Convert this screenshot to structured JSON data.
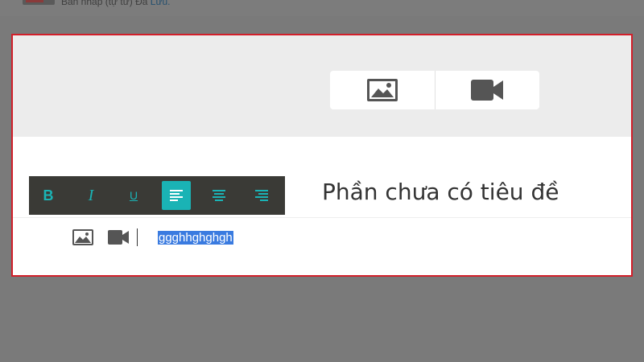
{
  "topbar": {
    "status_prefix": "Bản nháp (tự từ) Đã",
    "status_link": "Lưu."
  },
  "header": {
    "media_buttons": [
      {
        "icon": "image-icon",
        "label": ""
      },
      {
        "icon": "video-camera-icon",
        "label": ""
      }
    ]
  },
  "section": {
    "title": "Phần chưa có tiêu đề"
  },
  "format_toolbar": {
    "bold": "B",
    "italic": "I",
    "underline": "U",
    "active_button": "align-left",
    "align_left": "align-left",
    "align_center": "align-center",
    "align_right": "align-right"
  },
  "body": {
    "selected_text": "ggghhghghgh"
  },
  "colors": {
    "accent": "#1ab3b5",
    "highlight_border": "#d21f2a",
    "toolbar_bg": "#3a3a36",
    "selection": "#3a7be0"
  }
}
